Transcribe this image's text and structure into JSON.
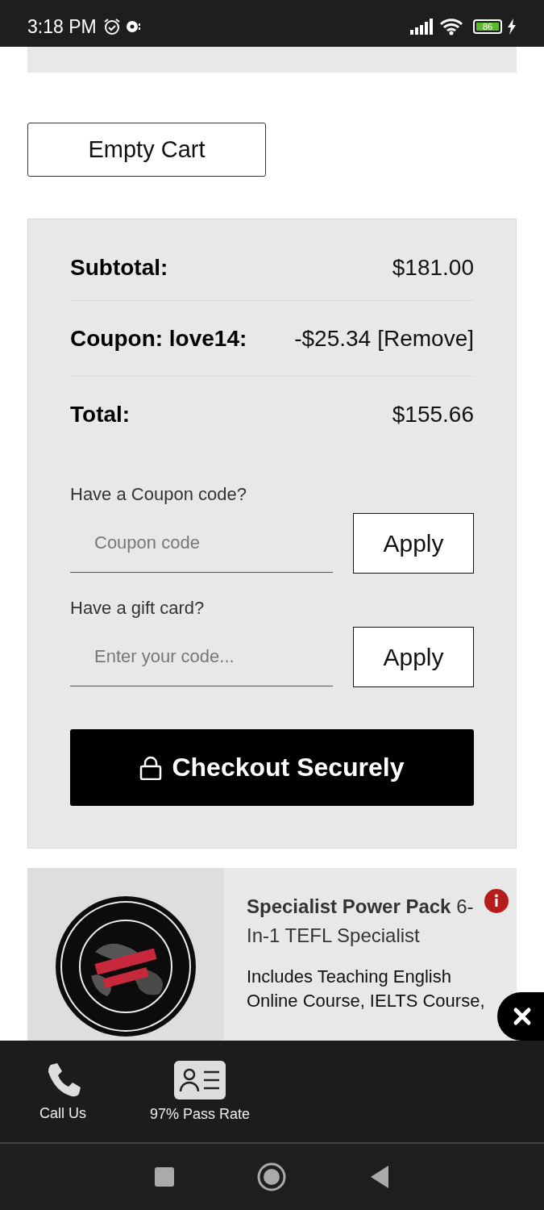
{
  "status_bar": {
    "time": "3:18 PM",
    "battery": "86"
  },
  "empty_cart_button": "Empty Cart",
  "summary": {
    "rows": [
      {
        "label": "Subtotal:",
        "value": "$181.00"
      },
      {
        "label": "Coupon: love14:",
        "value": "-$25.34",
        "link": "[Remove]"
      },
      {
        "label": "Total:",
        "value": "$155.66"
      }
    ],
    "coupon": {
      "label": "Have a Coupon code?",
      "placeholder": "Coupon code",
      "button": "Apply"
    },
    "gift_card": {
      "label": "Have a gift card?",
      "placeholder": "Enter your code...",
      "button": "Apply"
    },
    "checkout_button": "Checkout Securely"
  },
  "product": {
    "title": "**Specialist Power Pack** 6-In-1 TEFL Specialist",
    "description": "Includes Teaching English Online Course, IELTS Course,"
  },
  "bottom_bar": [
    {
      "kind": "phone",
      "label": "Call Us"
    },
    {
      "kind": "id-card",
      "label": "97% Pass Rate"
    }
  ]
}
